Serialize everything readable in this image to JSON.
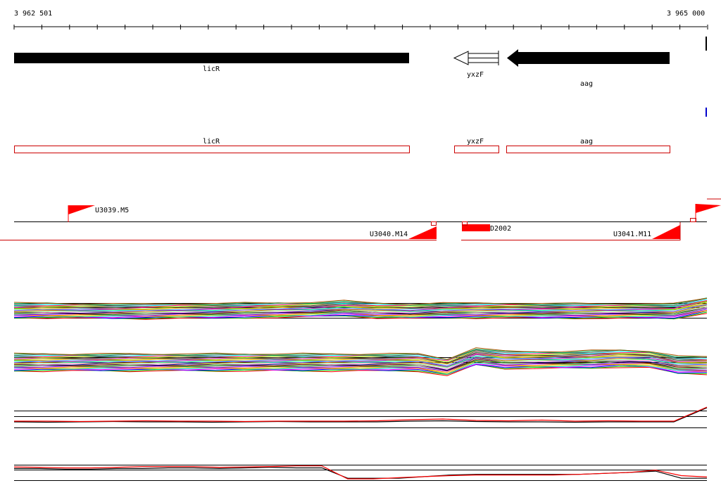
{
  "ruler": {
    "start_label": "3 962 501",
    "end_label": "3 965 000"
  },
  "genes": [
    {
      "name": "licR",
      "strand": "-",
      "style": "solid",
      "start": 3962501,
      "end": 3963925
    },
    {
      "name": "yxzF",
      "strand": "-",
      "style": "open",
      "start": 3964090,
      "end": 3964250
    },
    {
      "name": "aag",
      "strand": "-",
      "style": "solid",
      "start": 3964280,
      "end": 3964875
    }
  ],
  "cds_boxes": [
    {
      "name": "licR",
      "start": 3962501,
      "end": 3963925
    },
    {
      "name": "yxzF",
      "start": 3964134,
      "end": 3964250
    },
    {
      "name": "aag",
      "start": 3964280,
      "end": 3964875
    }
  ],
  "transcription_units": [
    {
      "label": "U3039.M5",
      "strand": "+"
    },
    {
      "label": "U3040.M14",
      "strand": "-"
    },
    {
      "label": "D2002",
      "strand": "+"
    },
    {
      "label": "U3041.M11",
      "strand": "-"
    }
  ],
  "colors": {
    "gene_solid": "#000000",
    "cds_box": "#cc0000",
    "promoter": "#ff0000",
    "unit_line": "#cc0000",
    "track_black": "#000000",
    "track_red": "#ff0000",
    "marker_blue": "#0000cc"
  },
  "expression_tracks": [
    {
      "id": "track-1",
      "type": "multi-series-line",
      "series_count": 30,
      "profile": [
        0.48,
        0.48,
        0.47,
        0.46,
        0.46,
        0.47,
        0.47,
        0.48,
        0.49,
        0.5,
        0.53,
        0.48,
        0.46,
        0.48,
        0.48,
        0.48,
        0.47,
        0.47,
        0.47,
        0.47,
        0.46,
        0.6
      ]
    },
    {
      "id": "track-2",
      "type": "multi-series-line",
      "series_count": 30,
      "profile": [
        0.5,
        0.5,
        0.5,
        0.5,
        0.5,
        0.5,
        0.5,
        0.5,
        0.5,
        0.5,
        0.5,
        0.5,
        0.5,
        0.5,
        0.5,
        0.4,
        0.62,
        0.55,
        0.55,
        0.55,
        0.56,
        0.58,
        0.56,
        0.45,
        0.44
      ]
    },
    {
      "id": "track-3",
      "type": "two-series-line",
      "series_count": 2,
      "black": [
        0.5,
        0.49,
        0.5,
        0.51,
        0.5,
        0.5,
        0.49,
        0.5,
        0.51,
        0.5,
        0.5,
        0.5,
        0.52,
        0.53,
        0.51,
        0.5,
        0.5,
        0.49,
        0.5,
        0.5,
        0.5,
        0.9
      ],
      "red": [
        0.52,
        0.52,
        0.51,
        0.52,
        0.53,
        0.52,
        0.52,
        0.51,
        0.52,
        0.52,
        0.52,
        0.53,
        0.56,
        0.58,
        0.54,
        0.53,
        0.55,
        0.52,
        0.53,
        0.52,
        0.52,
        0.92
      ]
    },
    {
      "id": "track-4",
      "type": "two-series-line",
      "series_count": 2,
      "black": [
        0.6,
        0.6,
        0.58,
        0.58,
        0.6,
        0.6,
        0.62,
        0.62,
        0.6,
        0.62,
        0.64,
        0.62,
        0.62,
        0.3,
        0.3,
        0.3,
        0.35,
        0.4,
        0.42,
        0.42,
        0.42,
        0.42,
        0.42,
        0.45,
        0.48,
        0.52,
        0.3,
        0.3
      ],
      "red": [
        0.65,
        0.64,
        0.62,
        0.62,
        0.64,
        0.66,
        0.66,
        0.66,
        0.64,
        0.65,
        0.66,
        0.68,
        0.68,
        0.28,
        0.28,
        0.32,
        0.35,
        0.38,
        0.4,
        0.4,
        0.4,
        0.4,
        0.42,
        0.45,
        0.48,
        0.55,
        0.38,
        0.34
      ]
    }
  ]
}
